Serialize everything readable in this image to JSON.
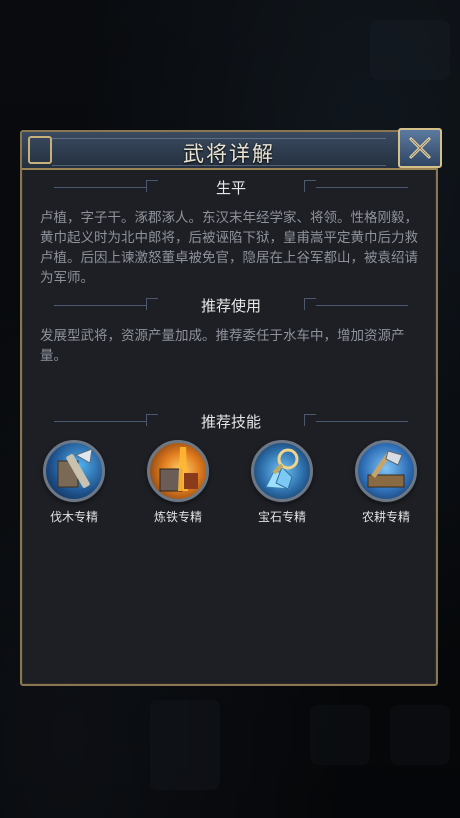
{
  "dialog": {
    "title": "武将详解",
    "close_icon": "close-x-icon"
  },
  "sections": {
    "biography": {
      "title": "生平",
      "text": "卢植，字子干。涿郡涿人。东汉末年经学家、将领。性格刚毅，黄巾起义时为北中郎将，后被诬陷下狱，皇甫嵩平定黄巾后力救卢植。后因上谏激怒董卓被免官，隐居在上谷军都山，被袁绍请为军师。"
    },
    "recommended_use": {
      "title": "推荐使用",
      "text": "发展型武将，资源产量加成。推荐委任于水车中，增加资源产量。"
    },
    "recommended_skills": {
      "title": "推荐技能",
      "skills": [
        {
          "label": "伐木专精",
          "icon": "axe-lumber-icon",
          "accent": "#3b8fd6"
        },
        {
          "label": "炼铁专精",
          "icon": "molten-iron-icon",
          "accent": "#e8902a"
        },
        {
          "label": "宝石专精",
          "icon": "magnifier-gem-icon",
          "accent": "#4aa6e6"
        },
        {
          "label": "农耕专精",
          "icon": "hoe-farming-icon",
          "accent": "#2f7fd0"
        }
      ]
    }
  },
  "colors": {
    "panel_bg": "#1d1f24",
    "gold_border": "#8a7650",
    "header_blue": "#3a4a60",
    "body_text": "#8d929b"
  }
}
